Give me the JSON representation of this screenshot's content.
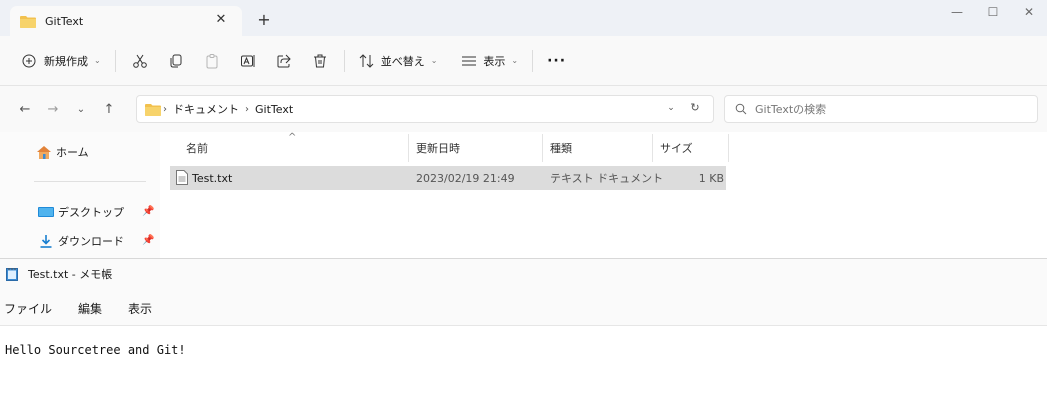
{
  "explorer": {
    "tab": {
      "title": "GitText",
      "close": "✕",
      "new_tab": "+"
    },
    "window_controls": {
      "minimize": "—",
      "maximize": "☐",
      "close": "✕"
    },
    "toolbar": {
      "new_label": "新規作成",
      "sort_label": "並べ替え",
      "view_label": "表示",
      "more_label": "···"
    },
    "address": {
      "crumbs": [
        "ドキュメント",
        "GitText"
      ],
      "search_placeholder": "GitTextの検索"
    },
    "nav": {
      "home": "ホーム",
      "desktop": "デスクトップ",
      "downloads": "ダウンロード"
    },
    "columns": {
      "name": "名前",
      "modified": "更新日時",
      "type": "種類",
      "size": "サイズ"
    },
    "files": [
      {
        "name": "Test.txt",
        "modified": "2023/02/19 21:49",
        "type": "テキスト ドキュメント",
        "size": "1 KB"
      }
    ]
  },
  "notepad": {
    "title": "Test.txt - メモ帳",
    "menu": [
      "ファイル",
      "編集",
      "表示"
    ],
    "content": "Hello Sourcetree and Git!"
  },
  "colors": {
    "folder": "#f2c14e",
    "selection": "#dcdcdc",
    "tabbar": "#eef1f6"
  }
}
